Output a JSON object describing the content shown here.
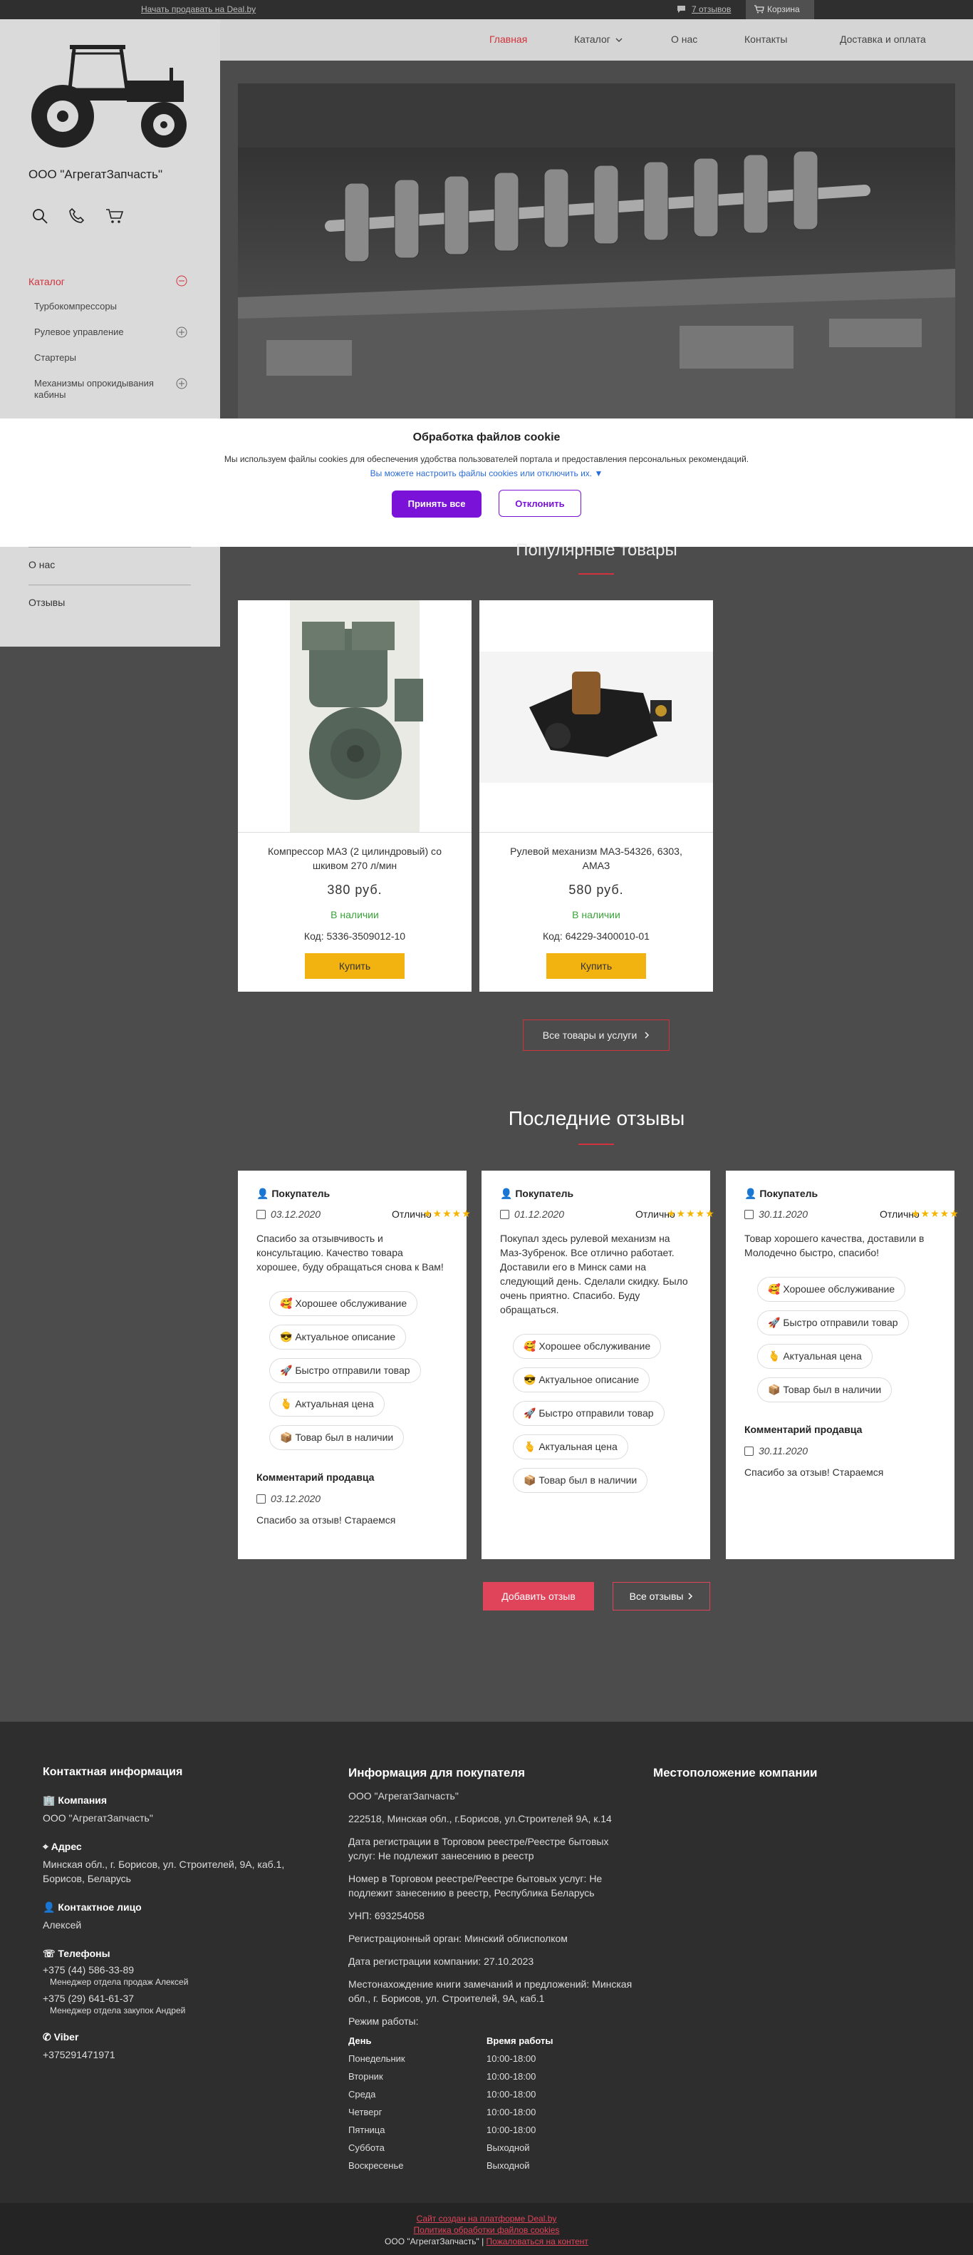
{
  "topbar": {
    "sell_link": "Начать продавать на Deal.by",
    "reviews_link": "7 отзывов",
    "cart": "Корзина"
  },
  "sidebar": {
    "company_name": "ООО \"АгрегатЗапчасть\"",
    "catalog_label": "Каталог",
    "catalog_items": [
      {
        "label": "Турбокомпрессоры",
        "expandable": false
      },
      {
        "label": "Рулевое управление",
        "expandable": true
      },
      {
        "label": "Стартеры",
        "expandable": false
      },
      {
        "label": "Механизмы опрокидывания кабины",
        "expandable": true
      }
    ],
    "lower_items": [
      "О нас",
      "Отзывы"
    ]
  },
  "nav": {
    "items": [
      "Главная",
      "Каталог",
      "О нас",
      "Контакты",
      "Доставка и оплата"
    ],
    "active_color": "#d2323c"
  },
  "cookie": {
    "title": "Обработка файлов cookie",
    "text": "Мы используем файлы cookies для обеспечения удобства пользователей портала и предоставления персональных рекомендаций.",
    "link": "Вы можете настроить файлы cookies или отключить их. ▼",
    "accept": "Принять все",
    "decline": "Отклонить"
  },
  "popular": {
    "title": "Популярные товары",
    "products": [
      {
        "name": "Компрессор МАЗ (2 цилиндровый) со шкивом 270 л/мин",
        "price": "380 руб.",
        "availability": "В наличии",
        "code": "Код: 5336-3509012-10",
        "buy": "Купить"
      },
      {
        "name": "Рулевой механизм МАЗ-54326, 6303, АМАЗ",
        "price": "580 руб.",
        "availability": "В наличии",
        "code": "Код: 64229-3400010-01",
        "buy": "Купить"
      }
    ],
    "all_button": "Все товары и услуги"
  },
  "reviews": {
    "title": "Последние отзывы",
    "items": [
      {
        "user": "Покупатель",
        "date": "03.12.2020",
        "rating": "Отлично",
        "stars": "★★★★★",
        "text": "Спасибо за отзывчивость и консультацию. Качество товара хорошее, буду обращаться снова к Вам!",
        "tags": [
          {
            "emoji": "🥰",
            "label": "Хорошее обслуживание"
          },
          {
            "emoji": "😎",
            "label": "Актуальное описание"
          },
          {
            "emoji": "🚀",
            "label": "Быстро отправили товар"
          },
          {
            "emoji": "🫰",
            "label": "Актуальная цена"
          },
          {
            "emoji": "📦",
            "label": "Товар был в наличии"
          }
        ],
        "seller_comment_label": "Комментарий продавца",
        "seller_date": "03.12.2020",
        "seller_text": "Спасибо за отзыв! Стараемся"
      },
      {
        "user": "Покупатель",
        "date": "01.12.2020",
        "rating": "Отлично",
        "stars": "★★★★★",
        "text": "Покупал здесь рулевой механизм на Маз-Зубренок. Все отлично работает. Доставили его в Минск сами на следующий день. Сделали скидку. Было очень приятно. Спасибо. Буду обращаться.",
        "tags": [
          {
            "emoji": "🥰",
            "label": "Хорошее обслуживание"
          },
          {
            "emoji": "😎",
            "label": "Актуальное описание"
          },
          {
            "emoji": "🚀",
            "label": "Быстро отправили товар"
          },
          {
            "emoji": "🫰",
            "label": "Актуальная цена"
          },
          {
            "emoji": "📦",
            "label": "Товар был в наличии"
          }
        ],
        "seller_comment_label": "",
        "seller_date": "",
        "seller_text": ""
      },
      {
        "user": "Покупатель",
        "date": "30.11.2020",
        "rating": "Отлично",
        "stars": "★★★★★",
        "text": "Товар хорошего качества, доставили в Молодечно быстро, спасибо!",
        "tags": [
          {
            "emoji": "🥰",
            "label": "Хорошее обслуживание"
          },
          {
            "emoji": "🚀",
            "label": "Быстро отправили товар"
          },
          {
            "emoji": "🫰",
            "label": "Актуальная цена"
          },
          {
            "emoji": "📦",
            "label": "Товар был в наличии"
          }
        ],
        "seller_comment_label": "Комментарий продавца",
        "seller_date": "30.11.2020",
        "seller_text": "Спасибо за отзыв! Стараемся"
      }
    ],
    "add_button": "Добавить отзыв",
    "all_button": "Все отзывы"
  },
  "footer": {
    "contact_title": "Контактная информация",
    "company_label": "Компания",
    "company_value": "ООО \"АгрегатЗапчасть\"",
    "address_label": "Адрес",
    "address_value": "Минская обл., г. Борисов, ул. Строителей, 9А, каб.1, Борисов, Беларусь",
    "person_label": "Контактное лицо",
    "person_value": "Алексей",
    "phones_label": "Телефоны",
    "phone1": "+375 (44) 586-33-89",
    "phone1_note": "Менеджер отдела продаж Алексей",
    "phone2": "+375 (29) 641-61-37",
    "phone2_note": "Менеджер отдела закупок Андрей",
    "viber_label": "Viber",
    "viber_value": "+375291471971",
    "buyer_title": "Информация для покупателя",
    "buyer_lines": [
      "ООО \"АгрегатЗапчасть\"",
      "222518, Минская обл., г.Борисов, ул.Строителей 9А, к.14",
      "Дата регистрации в Торговом реестре/Реестре бытовых услуг: Не подлежит занесению в реестр",
      "Номер в Торговом реестре/Реестре бытовых услуг: Не подлежит занесению в реестр, Республика Беларусь",
      "УНП: 693254058",
      "Регистрационный орган: Минский облисполком",
      "Дата регистрации компании: 27.10.2023",
      "Местонахождение книги замечаний и предложений: Минская обл., г. Борисов, ул. Строителей, 9А, каб.1"
    ],
    "hours_label": "Режим работы:",
    "hours_head_day": "День",
    "hours_head_time": "Время работы",
    "hours": [
      {
        "day": "Понедельник",
        "time": "10:00-18:00"
      },
      {
        "day": "Вторник",
        "time": "10:00-18:00"
      },
      {
        "day": "Среда",
        "time": "10:00-18:00"
      },
      {
        "day": "Четверг",
        "time": "10:00-18:00"
      },
      {
        "day": "Пятница",
        "time": "10:00-18:00"
      },
      {
        "day": "Суббота",
        "time": "Выходной"
      },
      {
        "day": "Воскресенье",
        "time": "Выходной"
      }
    ],
    "location_title": "Местоположение компании"
  },
  "bottom": {
    "created": "Сайт создан на платформе Deal.by",
    "policy": "Политика обработки файлов cookies",
    "company": "ООО \"АгрегатЗапчасть\"",
    "separator": " | ",
    "complain": "Пожаловаться на контент"
  }
}
